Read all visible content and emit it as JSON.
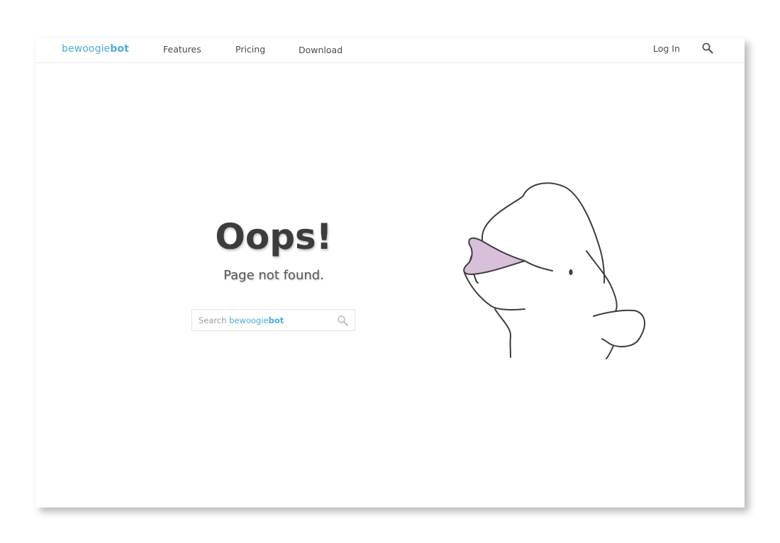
{
  "nav": {
    "logo_light": "bewoogie",
    "logo_bold": "bot",
    "features": "Features",
    "pricing": "Pricing",
    "download": "Download",
    "login": "Log In"
  },
  "main": {
    "heading": "Oops!",
    "subheading": "Page not found.",
    "search": {
      "placeholder_prefix": "Search",
      "placeholder_brand_light": "bewoogie",
      "placeholder_brand_bold": "bot"
    }
  },
  "icons": {
    "nav_search": "search-icon",
    "box_search": "search-icon",
    "illustration": "beluga-illustration"
  },
  "colors": {
    "brand": "#4aaed8",
    "text": "#3c3c3c",
    "mouth": "#d8bfda"
  }
}
